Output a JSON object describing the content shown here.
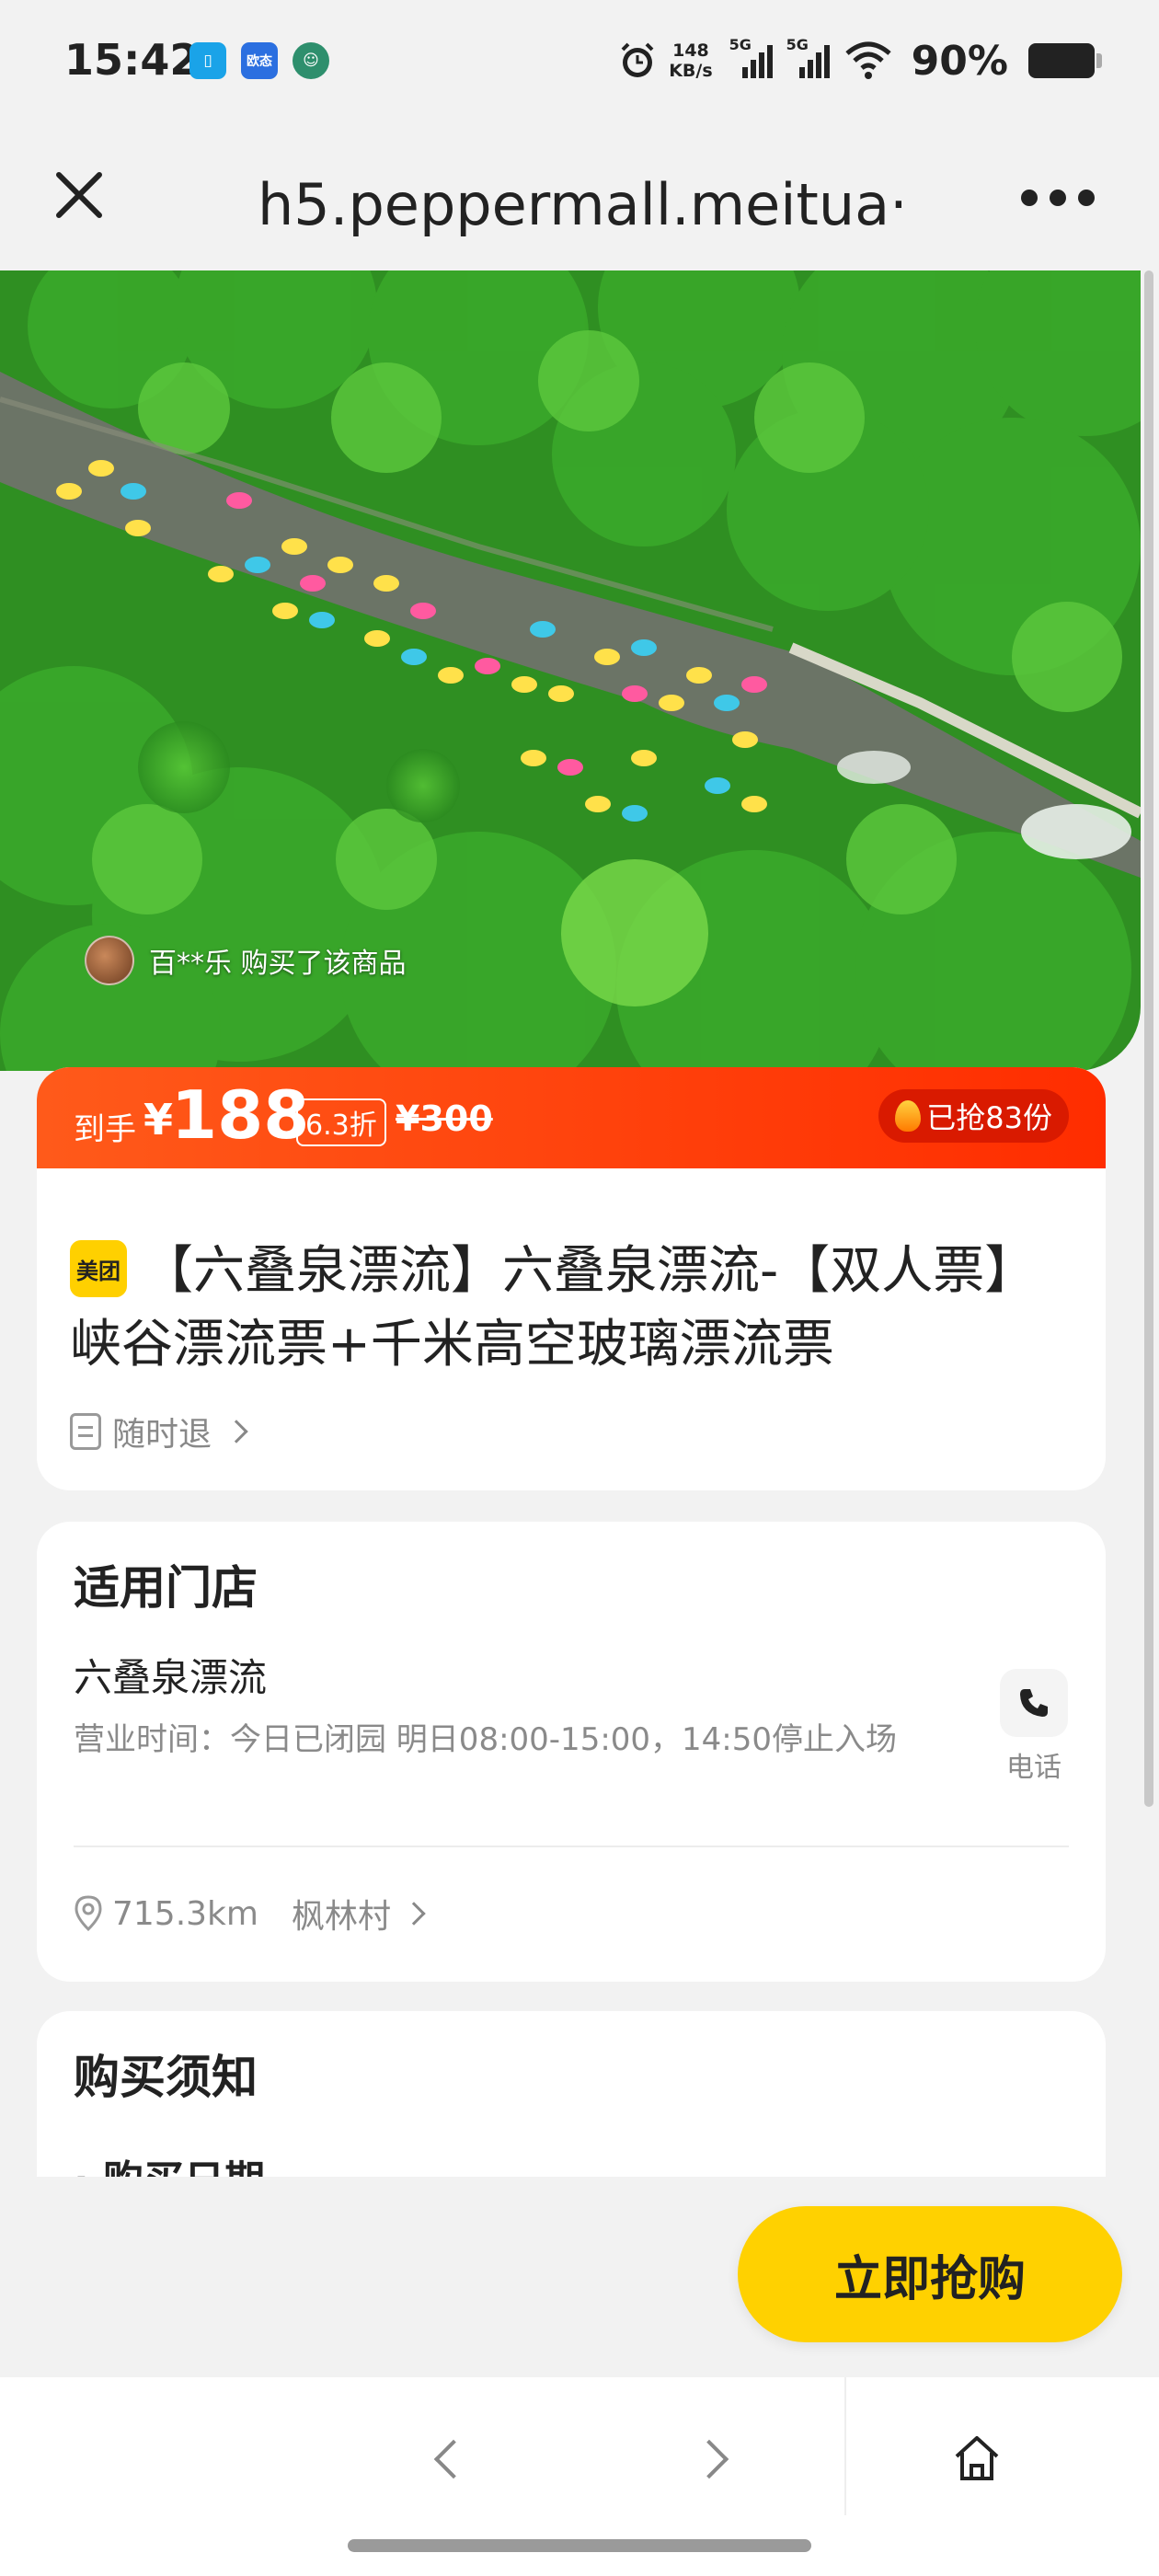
{
  "status_bar": {
    "time": "15:42",
    "app_icons": [
      "phone-app-icon",
      "oppo-app-icon",
      "avatar-app-icon"
    ],
    "app_icon_text": "欧态",
    "net_speed_value": "148",
    "net_speed_unit": "KB/s",
    "signal_1_label": "5G",
    "signal_2_label": "5G",
    "battery": "90%"
  },
  "nav": {
    "url_title": "h5.peppermall.meitua···"
  },
  "hero": {
    "buyer_notice": "百**乐 购买了该商品"
  },
  "deal": {
    "price_prefix": "到手",
    "currency": "¥",
    "price": "188",
    "discount": "6.3折",
    "original_price": "¥300",
    "sold": "已抢83份",
    "brand_logo_text": "美团",
    "title": "【六叠泉漂流】六叠泉漂流-【双人票】峡谷漂流票+千米高空玻璃漂流票",
    "refund_policy": "随时退"
  },
  "store": {
    "section_title": "适用门店",
    "name": "六叠泉漂流",
    "hours": "营业时间：今日已闭园 明日08:00-15:00，14:50停止入场",
    "phone_label": "电话",
    "distance": "715.3km",
    "area": "枫林村"
  },
  "notice": {
    "section_title": "购买须知",
    "first_item": "· 购买日期"
  },
  "actions": {
    "buy_now": "立即抢购"
  },
  "colors": {
    "price_bar": "#ff3d0d",
    "buy_button": "#ffd100",
    "brand_yellow": "#ffd000"
  }
}
